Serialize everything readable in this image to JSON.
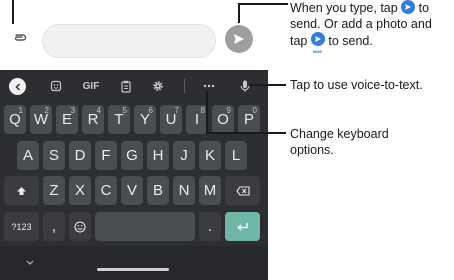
{
  "keyboard": {
    "toolbar": {
      "gif": "GIF"
    },
    "rows": {
      "row1": [
        {
          "key": "Q",
          "hint": "1"
        },
        {
          "key": "W",
          "hint": "2"
        },
        {
          "key": "E",
          "hint": "3"
        },
        {
          "key": "R",
          "hint": "4"
        },
        {
          "key": "T",
          "hint": "5"
        },
        {
          "key": "Y",
          "hint": "6"
        },
        {
          "key": "U",
          "hint": "7"
        },
        {
          "key": "I",
          "hint": "8"
        },
        {
          "key": "O",
          "hint": "9"
        },
        {
          "key": "P",
          "hint": "0"
        }
      ],
      "row2": [
        "A",
        "S",
        "D",
        "F",
        "G",
        "H",
        "J",
        "K",
        "L"
      ],
      "row3": [
        "Z",
        "X",
        "C",
        "V",
        "B",
        "N",
        "M"
      ],
      "row4": {
        "symbols": "?123",
        "comma": ",",
        "period": "."
      }
    }
  },
  "callouts": {
    "send_line1_a": "When you type, tap",
    "send_line1_b": "to",
    "send_line2": "send. Or add a photo and",
    "send_line3_a": "tap",
    "send_line3_b": "to send.",
    "mms_label": "MMS",
    "voice": "Tap to use voice-to-text.",
    "options_line1": "Change keyboard",
    "options_line2": "options."
  },
  "colors": {
    "keyboard_bg": "#2c2e31",
    "key_bg": "#4a4d51",
    "enter_key": "#6fb8a8",
    "send_icon_accent": "#2f7de1"
  }
}
